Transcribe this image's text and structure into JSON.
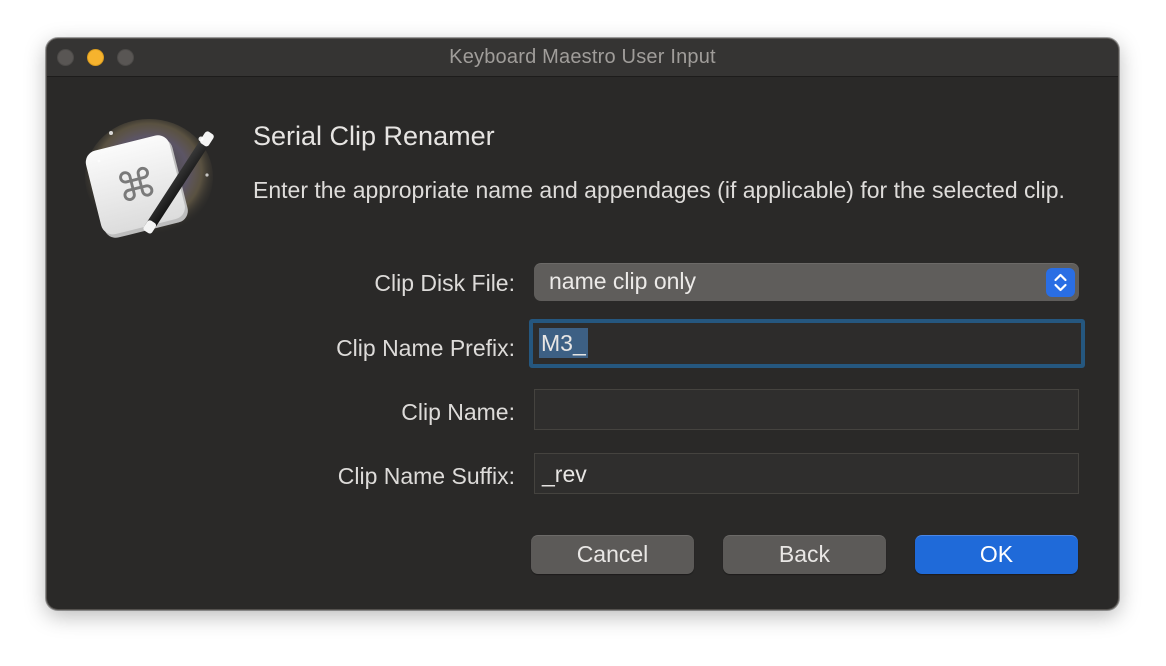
{
  "window": {
    "title": "Keyboard Maestro User Input"
  },
  "app_icon": {
    "name": "keyboard-maestro-icon",
    "glyph": "⌘"
  },
  "dialog": {
    "heading": "Serial Clip Renamer",
    "message": "Enter the appropriate name and appendages (if applicable) for the selected clip."
  },
  "form": {
    "disk_file": {
      "label": "Clip Disk File:",
      "value": "name clip only"
    },
    "prefix": {
      "label": "Clip Name Prefix:",
      "value": "M3_"
    },
    "name": {
      "label": "Clip Name:",
      "value": ""
    },
    "suffix": {
      "label": "Clip Name Suffix:",
      "value": "_rev"
    }
  },
  "buttons": {
    "cancel": "Cancel",
    "back": "Back",
    "ok": "OK"
  },
  "colors": {
    "accent": "#1f6ad9",
    "focus_ring": "#25577f",
    "window_bg": "#2a2928",
    "minimize": "#f6b32e"
  }
}
